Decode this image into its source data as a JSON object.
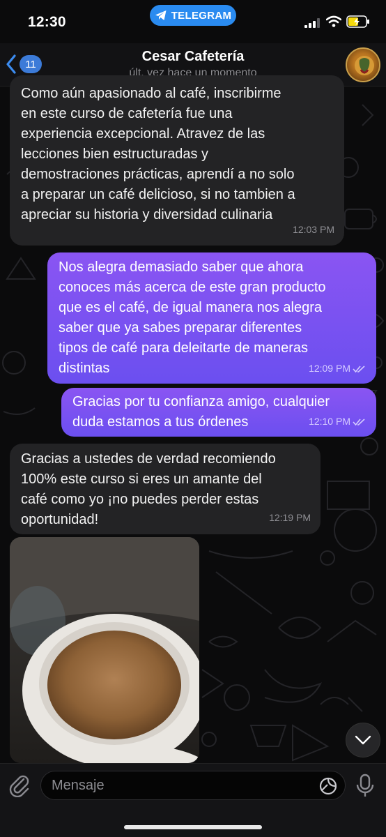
{
  "status_bar": {
    "time": "12:30",
    "app_pill": "TELEGRAM",
    "accent_color": "#2a8bf0"
  },
  "header": {
    "back_count": "11",
    "title": "Cesar Cafetería",
    "subtitle": "últ. vez hace un momento"
  },
  "messages": [
    {
      "direction": "incoming",
      "lines": [
        "Como aún apasionado al café,  inscribirme",
        "en este curso de cafetería fue una",
        "experiencia excepcional. Atravez de las",
        "lecciones bien estructuradas y",
        "demostraciones prácticas, aprendí a no solo",
        "a preparar un café delicioso, si no tambien a",
        "apreciar su historia y diversidad culinaria"
      ],
      "time": "12:03 PM"
    },
    {
      "direction": "outgoing",
      "lines": [
        "Nos alegra demasiado saber que ahora",
        "conoces más acerca de este gran producto",
        "que es el café, de igual manera nos alegra",
        "saber que ya sabes preparar diferentes",
        "tipos de café para deleitarte de maneras",
        "distintas"
      ],
      "time": "12:09 PM",
      "read": true
    },
    {
      "direction": "outgoing",
      "lines": [
        "Gracias por tu confianza amigo, cualquier",
        "duda estamos a tus órdenes"
      ],
      "time": "12:10 PM",
      "read": true
    },
    {
      "direction": "incoming",
      "lines": [
        "Gracias a ustedes de verdad recomiendo",
        "100% este curso  si eres  un amante del",
        "café como yo ¡no puedes perder estas",
        "oportunidad!"
      ],
      "time": "12:19 PM"
    }
  ],
  "photo": {
    "subject": "cup-of-coffee"
  },
  "input": {
    "placeholder": "Mensaje"
  },
  "colors": {
    "incoming_bubble": "#232325",
    "outgoing_bubble": "#7a52f2",
    "background": "#0b0b0c"
  }
}
